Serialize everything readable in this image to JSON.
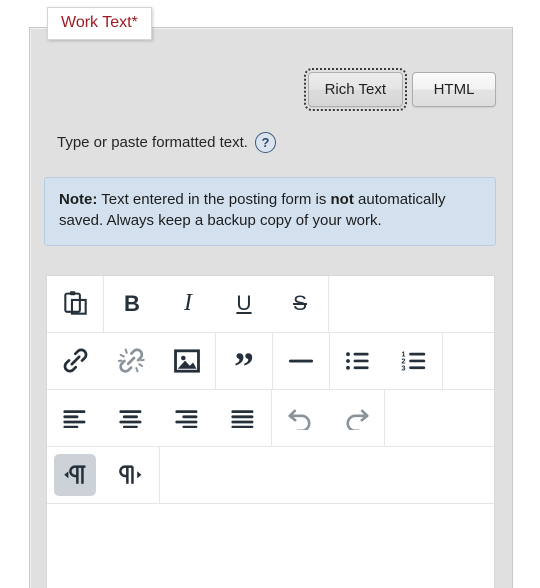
{
  "field": {
    "label": "Work Text*"
  },
  "mode_toggle": {
    "options": [
      {
        "label": "Rich Text",
        "active": true
      },
      {
        "label": "HTML",
        "active": false
      }
    ]
  },
  "helper": {
    "text": "Type or paste formatted text.",
    "help_icon": "help-question-icon",
    "help_glyph": "?"
  },
  "note": {
    "bold_lead": "Note:",
    "body_part1": " Text entered in the posting form is ",
    "bold_inline": "not",
    "body_part2": " automatically saved. Always keep a backup copy of your work."
  },
  "toolbar": {
    "rows": [
      {
        "groups": [
          {
            "buttons": [
              {
                "name": "paste-button",
                "icon": "paste-icon",
                "state": "enabled"
              }
            ]
          },
          {
            "buttons": [
              {
                "name": "bold-button",
                "icon": "bold-icon",
                "glyph": "B",
                "state": "enabled"
              },
              {
                "name": "italic-button",
                "icon": "italic-icon",
                "glyph": "I",
                "state": "enabled"
              },
              {
                "name": "underline-button",
                "icon": "underline-icon",
                "glyph": "U",
                "state": "enabled"
              },
              {
                "name": "strikethrough-button",
                "icon": "strikethrough-icon",
                "glyph": "S",
                "state": "enabled"
              }
            ]
          }
        ]
      },
      {
        "groups": [
          {
            "buttons": [
              {
                "name": "link-button",
                "icon": "link-icon",
                "state": "enabled"
              },
              {
                "name": "unlink-button",
                "icon": "unlink-icon",
                "state": "disabled"
              },
              {
                "name": "image-button",
                "icon": "image-icon",
                "state": "enabled"
              }
            ]
          },
          {
            "buttons": [
              {
                "name": "blockquote-button",
                "icon": "quote-icon",
                "glyph": "”",
                "state": "enabled"
              }
            ]
          },
          {
            "buttons": [
              {
                "name": "horizontal-rule-button",
                "icon": "horizontal-rule-icon",
                "state": "enabled"
              }
            ]
          },
          {
            "buttons": [
              {
                "name": "bulleted-list-button",
                "icon": "bulleted-list-icon",
                "state": "enabled"
              },
              {
                "name": "numbered-list-button",
                "icon": "numbered-list-icon",
                "state": "enabled"
              }
            ]
          }
        ]
      },
      {
        "groups": [
          {
            "buttons": [
              {
                "name": "align-left-button",
                "icon": "align-left-icon",
                "state": "enabled"
              },
              {
                "name": "align-center-button",
                "icon": "align-center-icon",
                "state": "enabled"
              },
              {
                "name": "align-right-button",
                "icon": "align-right-icon",
                "state": "enabled"
              },
              {
                "name": "align-justify-button",
                "icon": "align-justify-icon",
                "state": "enabled"
              }
            ]
          },
          {
            "buttons": [
              {
                "name": "undo-button",
                "icon": "undo-icon",
                "state": "disabled"
              },
              {
                "name": "redo-button",
                "icon": "redo-icon",
                "state": "disabled"
              }
            ]
          }
        ]
      },
      {
        "groups": [
          {
            "buttons": [
              {
                "name": "text-direction-ltr-button",
                "icon": "paragraph-ltr-icon",
                "state": "active"
              },
              {
                "name": "text-direction-rtl-button",
                "icon": "paragraph-rtl-icon",
                "state": "enabled"
              }
            ]
          }
        ]
      }
    ]
  },
  "editor_body": {
    "content": "",
    "placeholder": ""
  },
  "colors": {
    "panel_bg": "#e0e0e0",
    "note_bg": "#d3e1ef",
    "note_border": "#b8cde0",
    "legend_text": "#9b1c24",
    "icon_ink": "#25303b",
    "icon_disabled": "#aab1b8",
    "active_chip": "#cdd2d9"
  }
}
